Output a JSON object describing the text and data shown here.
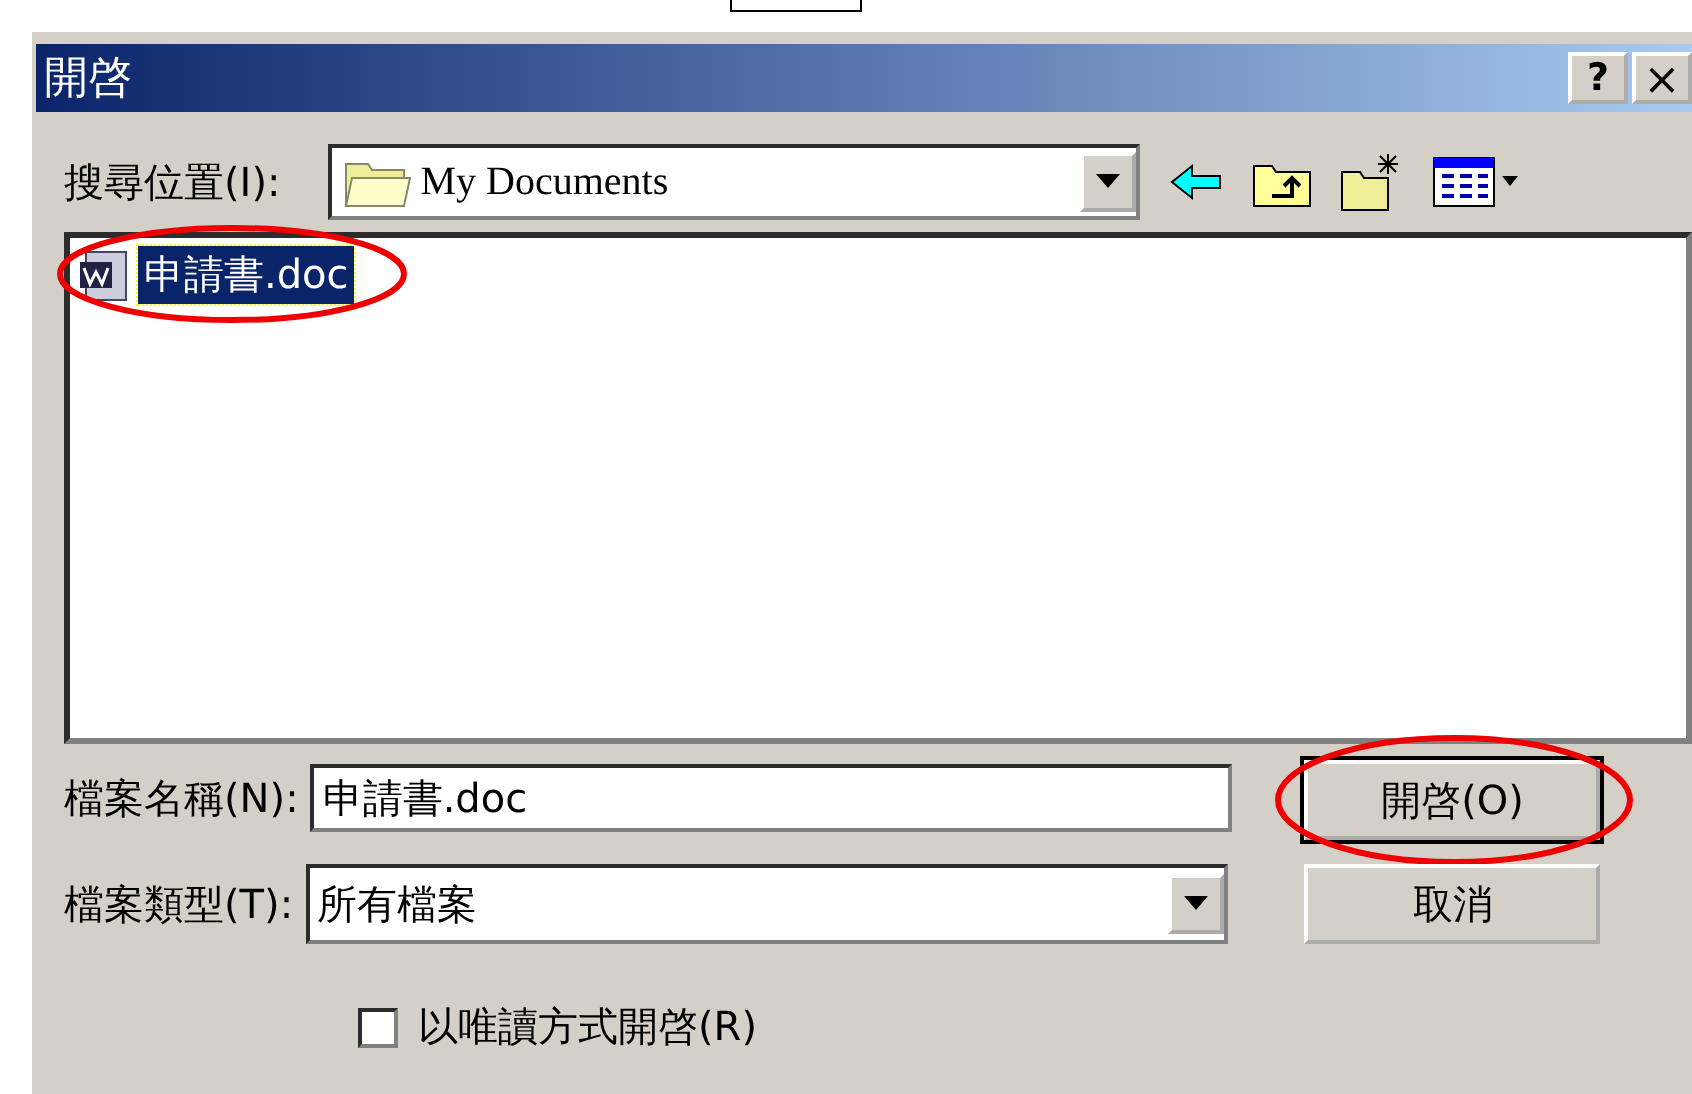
{
  "window": {
    "title": "開啓",
    "buttons": [
      {
        "kind": "help",
        "label": "?"
      },
      {
        "kind": "close",
        "label": "×"
      }
    ]
  },
  "look_in": {
    "label": "搜尋位置(I):",
    "value": "My Documents"
  },
  "toolbar": [
    {
      "kind": "back"
    },
    {
      "kind": "up"
    },
    {
      "kind": "new-folder"
    },
    {
      "kind": "view"
    }
  ],
  "files": [
    {
      "name": "申請書.doc",
      "selected": true,
      "highlighted": true
    }
  ],
  "file_name": {
    "label": "檔案名稱(N):",
    "value": "申請書.doc"
  },
  "file_type": {
    "label": "檔案類型(T):",
    "value": "所有檔案"
  },
  "buttons": [
    {
      "label": "開啓(O)",
      "default": true,
      "highlighted": true
    },
    {
      "label": "取消",
      "default": false,
      "highlighted": false
    }
  ],
  "read_only": {
    "label": "以唯讀方式開啓(R)",
    "checked": false
  }
}
